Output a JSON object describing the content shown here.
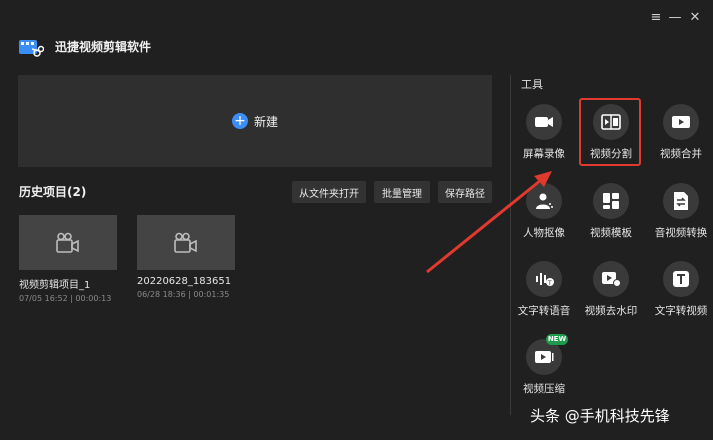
{
  "app": {
    "title": "迅捷视频剪辑软件"
  },
  "window_controls": {
    "menu": "≡",
    "minimize": "—",
    "close": "✕"
  },
  "new_panel": {
    "label": "新建",
    "plus": "+"
  },
  "history": {
    "title": "历史项目(2)",
    "buttons": [
      "从文件夹打开",
      "批量管理",
      "保存路径"
    ],
    "projects": [
      {
        "name": "视频剪辑项目_1",
        "meta": "07/05 16:52 | 00:00:13"
      },
      {
        "name": "20220628_183651",
        "meta": "06/28 18:36 | 00:01:35"
      }
    ]
  },
  "tools": {
    "title": "工具",
    "items": [
      {
        "label": "屏幕录像",
        "icon": "camera-icon"
      },
      {
        "label": "视频分割",
        "icon": "film-split-icon"
      },
      {
        "label": "视频合并",
        "icon": "play-icon"
      },
      {
        "label": "人物抠像",
        "icon": "person-icon"
      },
      {
        "label": "视频模板",
        "icon": "template-icon"
      },
      {
        "label": "音视频转换",
        "icon": "convert-icon"
      },
      {
        "label": "文字转语音",
        "icon": "text-to-speech-icon"
      },
      {
        "label": "视频去水印",
        "icon": "remove-watermark-icon"
      },
      {
        "label": "文字转视频",
        "icon": "text-to-video-icon"
      },
      {
        "label": "视频压缩",
        "icon": "compress-icon"
      }
    ],
    "new_badge": "NEW"
  },
  "watermark": "头条 @手机科技先锋",
  "colors": {
    "accent": "#3a8ef6",
    "highlight": "#e03a2e",
    "arrow": "#e03a2e",
    "badge": "#1f9a4c"
  }
}
